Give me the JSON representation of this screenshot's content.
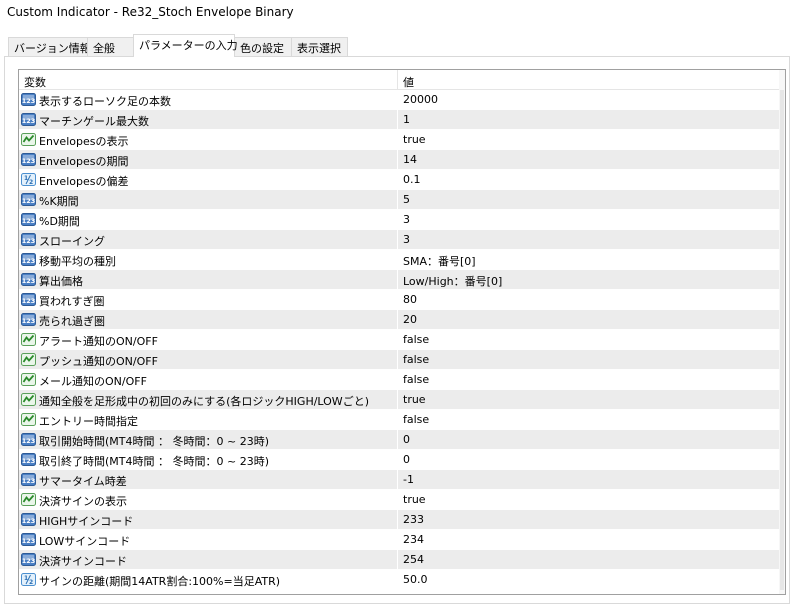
{
  "window": {
    "title": "Custom Indicator - Re32_Stoch Envelope Binary"
  },
  "tabs": [
    {
      "label": "バージョン情報",
      "active": false
    },
    {
      "label": "全般",
      "active": false
    },
    {
      "label": "パラメーターの入力",
      "active": true
    },
    {
      "label": "色の設定",
      "active": false
    },
    {
      "label": "表示選択",
      "active": false
    }
  ],
  "grid": {
    "col_name": "変数",
    "col_value": "値",
    "rows": [
      {
        "icon": "int-icon",
        "name": "表示するローソク足の本数",
        "value": "20000"
      },
      {
        "icon": "int-icon",
        "name": "マーチンゲール最大数",
        "value": "1"
      },
      {
        "icon": "bool-icon",
        "name": "Envelopesの表示",
        "value": "true"
      },
      {
        "icon": "int-icon",
        "name": "Envelopesの期間",
        "value": "14"
      },
      {
        "icon": "double-icon",
        "name": "Envelopesの偏差",
        "value": "0.1"
      },
      {
        "icon": "int-icon",
        "name": "%K期間",
        "value": "5"
      },
      {
        "icon": "int-icon",
        "name": "%D期間",
        "value": "3"
      },
      {
        "icon": "int-icon",
        "name": "スローイング",
        "value": "3"
      },
      {
        "icon": "int-icon",
        "name": "移動平均の種別",
        "value": "SMA：番号[0]"
      },
      {
        "icon": "int-icon",
        "name": "算出価格",
        "value": "Low/High：番号[0]"
      },
      {
        "icon": "int-icon",
        "name": "買われすぎ圏",
        "value": "80"
      },
      {
        "icon": "int-icon",
        "name": "売られ過ぎ圏",
        "value": "20"
      },
      {
        "icon": "bool-icon",
        "name": "アラート通知のON/OFF",
        "value": "false"
      },
      {
        "icon": "bool-icon",
        "name": "プッシュ通知のON/OFF",
        "value": "false"
      },
      {
        "icon": "bool-icon",
        "name": "メール通知のON/OFF",
        "value": "false"
      },
      {
        "icon": "bool-icon",
        "name": "通知全般を足形成中の初回のみにする(各ロジックHIGH/LOWごと)",
        "value": "true"
      },
      {
        "icon": "bool-icon",
        "name": "エントリー時間指定",
        "value": "false"
      },
      {
        "icon": "int-icon",
        "name": "取引開始時間(MT4時間 ： 冬時間：0 ~ 23時)",
        "value": "0"
      },
      {
        "icon": "int-icon",
        "name": "取引終了時間(MT4時間 ： 冬時間：0 ~ 23時)",
        "value": "0"
      },
      {
        "icon": "int-icon",
        "name": "サマータイム時差",
        "value": "-1"
      },
      {
        "icon": "bool-icon",
        "name": "決済サインの表示",
        "value": "true"
      },
      {
        "icon": "int-icon",
        "name": "HIGHサインコード",
        "value": "233"
      },
      {
        "icon": "int-icon",
        "name": "LOWサインコード",
        "value": "234"
      },
      {
        "icon": "int-icon",
        "name": "決済サインコード",
        "value": "254"
      },
      {
        "icon": "double-icon",
        "name": "サインの距離(期間14ATR割合:100%=当足ATR)",
        "value": "50.0"
      }
    ]
  },
  "colors": {
    "row_alt": "#ececec",
    "icon_int": "#3a6fb7",
    "icon_bool": "#2f9e44",
    "icon_double": "#3a86c8"
  }
}
